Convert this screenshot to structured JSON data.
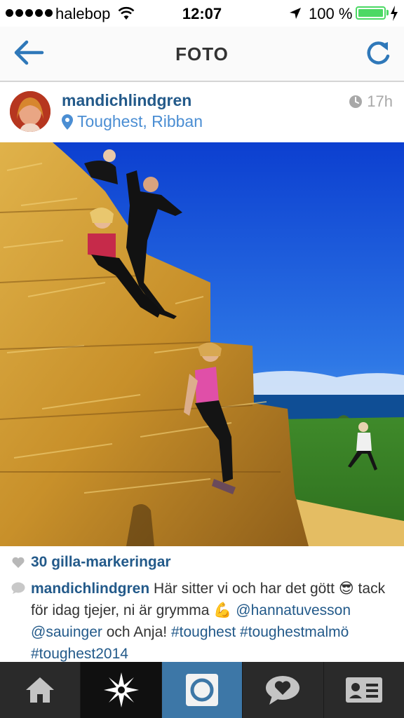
{
  "status_bar": {
    "carrier": "halebop",
    "time": "12:07",
    "battery": "100 %",
    "icons": [
      "signal-dots",
      "wifi-icon",
      "location-arrow-icon",
      "battery-icon",
      "charging-bolt-icon"
    ]
  },
  "nav": {
    "title": "FOTO",
    "back_icon": "back-arrow-icon",
    "refresh_icon": "refresh-icon"
  },
  "post": {
    "username": "mandichlindgren",
    "location": "Toughest, Ribban",
    "time_ago": "17h",
    "likes": "30 gilla-markeringar",
    "caption": {
      "username": "mandichlindgren",
      "text1": " Här sitter vi och har det gött ",
      "emoji1": "😎",
      "text2": " tack för idag tjejer, ni är grymma ",
      "emoji2": "💪",
      "mention1": "@hannatuvesson",
      "mention2": "@sauinger",
      "text3": " och Anja!",
      "tag1": "#toughest",
      "tag2": "#toughestmalmö",
      "tag3": "#toughest2014"
    }
  },
  "tabs": [
    {
      "name": "home",
      "icon": "home-icon"
    },
    {
      "name": "explore",
      "icon": "explore-star-icon"
    },
    {
      "name": "camera",
      "icon": "camera-icon"
    },
    {
      "name": "activity",
      "icon": "activity-heart-icon"
    },
    {
      "name": "profile",
      "icon": "profile-card-icon"
    }
  ],
  "colors": {
    "link": "#235a8a",
    "location": "#4b8ed3",
    "tab_bar": "#2a2a2a",
    "camera_tab": "#3d77a7",
    "battery": "#4cd964"
  }
}
